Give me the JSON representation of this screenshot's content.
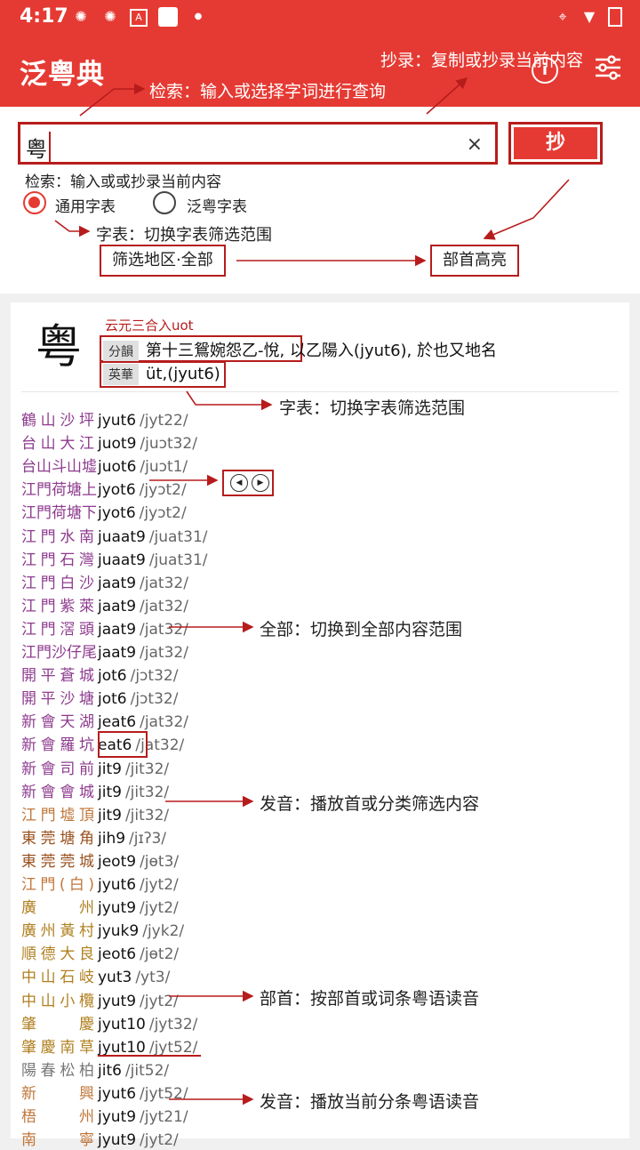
{
  "status": {
    "time": "4:17"
  },
  "app": {
    "title": "泛粤典",
    "info_icon": "info-icon",
    "filter_icon": "filter-icon"
  },
  "search": {
    "value": "粤",
    "clear": "×",
    "copy_label": "抄",
    "hint": "检索：输入或或抄录当前内容"
  },
  "dict_radio": [
    {
      "label": "通用字表",
      "selected": true
    },
    {
      "label": "泛粤字表",
      "selected": false
    }
  ],
  "filter_box": "筛选地区·全部",
  "radical_box": "部首高亮",
  "callouts": {
    "search": "检索：输入或选择字词进行查询",
    "copy": "抄录：复制或抄录当前内容",
    "dict": "字表：切换字表筛选范围",
    "dict2": "字表：切换字表筛选范围",
    "all": "全部：切换到全部内容范围",
    "pron": "发音：播放首或分类筛选内容",
    "radical": "部首：按部首或词条粤语读音",
    "play": "发音：播放当前分条粤语读音"
  },
  "entry": {
    "char": "粤",
    "header": "云元三合入uot",
    "rows": [
      {
        "tag": "分韻",
        "text": "第十三鴛婉怨乙-悅, 以乙陽入(jyut6), 於也又地名"
      },
      {
        "tag": "英華",
        "text": "üt,(jyut6)"
      }
    ],
    "audio_label": "◀"
  },
  "readings": [
    {
      "place": "鶴山沙坪",
      "code": "jyut6",
      "ipa": "/jyt22/",
      "color": "#8e3b8e"
    },
    {
      "place": "台山大江",
      "code": "juot9",
      "ipa": "/juɔt32/",
      "color": "#8e3b8e"
    },
    {
      "place": "台山斗山墟",
      "code": "juot6",
      "ipa": "/juɔt1/",
      "color": "#8e3b8e"
    },
    {
      "place": "江門荷塘上",
      "code": "jyot6",
      "ipa": "/jyɔt2/",
      "color": "#8e3b8e"
    },
    {
      "place": "江門荷塘下",
      "code": "jyot6",
      "ipa": "/jyɔt2/",
      "color": "#8e3b8e"
    },
    {
      "place": "江門水南",
      "code": "juaat9",
      "ipa": "/juat31/",
      "color": "#8e3b8e"
    },
    {
      "place": "江門石灣",
      "code": "juaat9",
      "ipa": "/juat31/",
      "color": "#8e3b8e"
    },
    {
      "place": "江門白沙",
      "code": "jaat9",
      "ipa": "/jat32/",
      "color": "#8e3b8e"
    },
    {
      "place": "江門紫萊",
      "code": "jaat9",
      "ipa": "/jat32/",
      "color": "#8e3b8e"
    },
    {
      "place": "江門滘頭",
      "code": "jaat9",
      "ipa": "/jat32/",
      "color": "#8e3b8e"
    },
    {
      "place": "江門沙仔尾",
      "code": "jaat9",
      "ipa": "/jat32/",
      "color": "#8e3b8e"
    },
    {
      "place": "開平蒼城",
      "code": "jot6",
      "ipa": "/jɔt32/",
      "color": "#8e3b8e"
    },
    {
      "place": "開平沙塘",
      "code": "jot6",
      "ipa": "/jɔt32/",
      "color": "#8e3b8e"
    },
    {
      "place": "新會天湖",
      "code": "jeat6",
      "ipa": "/jat32/",
      "color": "#8e3b8e"
    },
    {
      "place": "新會羅坑",
      "code": "eat6",
      "ipa": "/jat32/",
      "color": "#8e3b8e"
    },
    {
      "place": "新會司前",
      "code": "jit9",
      "ipa": "/jit32/",
      "color": "#8e3b8e"
    },
    {
      "place": "新會會城",
      "code": "jit9",
      "ipa": "/jit32/",
      "color": "#8e3b8e"
    },
    {
      "place": "江門墟頂",
      "code": "jit9",
      "ipa": "/jit32/",
      "color": "#c0763a"
    },
    {
      "place": "東莞塘角",
      "code": "jih9",
      "ipa": "/jɪʔ3/",
      "color": "#9a5220"
    },
    {
      "place": "東莞莞城",
      "code": "jeot9",
      "ipa": "/jɵt3/",
      "color": "#9a5220"
    },
    {
      "place": "江門(白)",
      "code": "jyut6",
      "ipa": "/jyt2/",
      "color": "#c0763a"
    },
    {
      "place": "廣　州",
      "code": "jyut9",
      "ipa": "/jyt2/",
      "color": "#b08020"
    },
    {
      "place": "廣州黃村",
      "code": "jyuk9",
      "ipa": "/jyk2/",
      "color": "#b08020"
    },
    {
      "place": "順德大良",
      "code": "jeot6",
      "ipa": "/jɵt2/",
      "color": "#b08020"
    },
    {
      "place": "中山石岐",
      "code": "yut3",
      "ipa": "/yt3/",
      "color": "#b08020"
    },
    {
      "place": "中山小欖",
      "code": "jyut9",
      "ipa": "/jyt2/",
      "color": "#b08020"
    },
    {
      "place": "肇　慶",
      "code": "jyut10",
      "ipa": "/jyt32/",
      "color": "#b08020"
    },
    {
      "place": "肇慶南草",
      "code": "jyut10",
      "ipa": "/jyt52/",
      "color": "#b08020"
    },
    {
      "place": "陽春松柏",
      "code": "jit6",
      "ipa": "/jit52/",
      "color": "#777777"
    },
    {
      "place": "新　興",
      "code": "jyut6",
      "ipa": "/jyt52/",
      "color": "#c0763a"
    },
    {
      "place": "梧　州",
      "code": "jyut9",
      "ipa": "/jyt21/",
      "color": "#c0763a"
    },
    {
      "place": "南　寧",
      "code": "jyut9",
      "ipa": "/jyt2/",
      "color": "#c0763a"
    }
  ]
}
